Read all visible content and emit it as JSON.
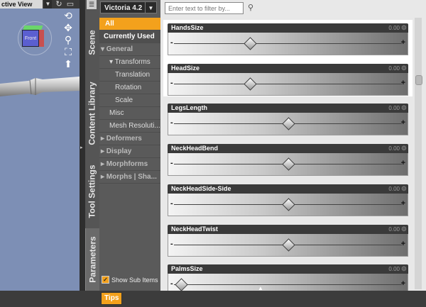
{
  "viewport": {
    "menu_label": "ctive View",
    "cube_label": "Front",
    "tool_icons": [
      "rotate-icon",
      "move-icon",
      "zoom-icon",
      "frame-icon",
      "reset-icon"
    ]
  },
  "tabs": [
    {
      "label": "Scene",
      "active": false
    },
    {
      "label": "Content Library",
      "active": false
    },
    {
      "label": "Tool Settings",
      "active": false
    },
    {
      "label": "Parameters",
      "active": true
    }
  ],
  "tree": {
    "figure": "Victoria 4.2",
    "items": [
      {
        "label": "All",
        "kind": "sel"
      },
      {
        "label": "Currently Used",
        "kind": "plain"
      },
      {
        "label": "▾ General",
        "kind": "group"
      },
      {
        "label": "▾ Transforms",
        "kind": "sub"
      },
      {
        "label": "Translation",
        "kind": "leaf"
      },
      {
        "label": "Rotation",
        "kind": "leaf"
      },
      {
        "label": "Scale",
        "kind": "leaf"
      },
      {
        "label": "Misc",
        "kind": "mid"
      },
      {
        "label": "Mesh Resoluti...",
        "kind": "mid"
      },
      {
        "label": "▸ Deformers",
        "kind": "group"
      },
      {
        "label": "▸ Display",
        "kind": "group"
      },
      {
        "label": "▸ Morphforms",
        "kind": "group"
      },
      {
        "label": "▸ Morphs | Sha...",
        "kind": "group"
      }
    ],
    "show_sub_items": "Show Sub Items"
  },
  "filter": {
    "placeholder": "Enter text to filter by..."
  },
  "sliders": [
    {
      "name": "HandsSize",
      "value": "0.00",
      "position": 0.33
    },
    {
      "name": "HeadSize",
      "value": "0.00",
      "position": 0.33
    },
    {
      "name": "LegsLength",
      "value": "0.00",
      "position": 0.5
    },
    {
      "name": "NeckHeadBend",
      "value": "0.00",
      "position": 0.5
    },
    {
      "name": "NeckHeadSide-Side",
      "value": "0.00",
      "position": 0.5
    },
    {
      "name": "NeckHeadTwist",
      "value": "0.00",
      "position": 0.5
    },
    {
      "name": "PalmsSize",
      "value": "0.00",
      "position": 0.02
    }
  ],
  "footer": {
    "tips_label": "Tips"
  },
  "colors": {
    "accent": "#f3a11c",
    "viewport": "#7d8fb5"
  }
}
